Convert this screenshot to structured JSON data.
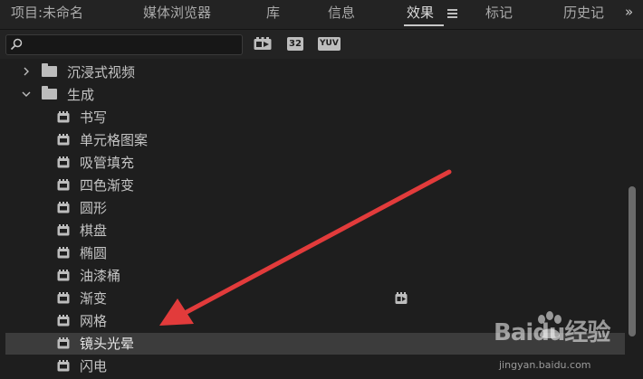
{
  "tabs": [
    {
      "label": "项目:未命名"
    },
    {
      "label": "媒体浏览器"
    },
    {
      "label": "库"
    },
    {
      "label": "信息"
    },
    {
      "label": "效果"
    },
    {
      "label": "标记"
    },
    {
      "label": "历史记"
    }
  ],
  "active_tab": "效果",
  "overflow_glyph": "»",
  "search": {
    "value": "",
    "placeholder": ""
  },
  "toolbar_badges": [
    "32",
    "YUV"
  ],
  "tree": {
    "folders": [
      {
        "label": "沉浸式视频",
        "expanded": false
      },
      {
        "label": "生成",
        "expanded": true
      }
    ],
    "effects": [
      {
        "label": "书写"
      },
      {
        "label": "单元格图案"
      },
      {
        "label": "吸管填充"
      },
      {
        "label": "四色渐变"
      },
      {
        "label": "圆形"
      },
      {
        "label": "棋盘"
      },
      {
        "label": "椭圆"
      },
      {
        "label": "油漆桶"
      },
      {
        "label": "渐变"
      },
      {
        "label": "网格"
      },
      {
        "label": "镜头光晕"
      },
      {
        "label": "闪电"
      }
    ],
    "selected": "镜头光晕",
    "gpu_accelerated": [
      "渐变"
    ]
  },
  "annotation_color": "#e23b3b",
  "watermark": {
    "brand": "Baidu经验",
    "sub": "jingyan.baidu.com"
  }
}
